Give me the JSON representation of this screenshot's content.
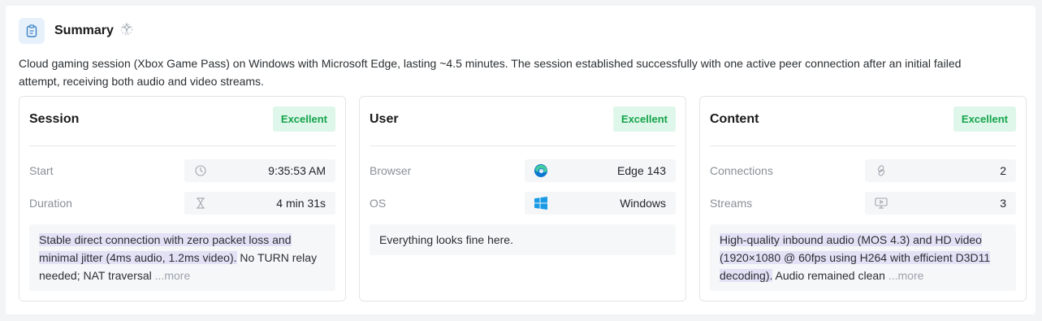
{
  "summary": {
    "title": "Summary",
    "description": "Cloud gaming session (Xbox Game Pass) on Windows with Microsoft Edge, lasting ~4.5 minutes. The session established successfully with one active peer connection after an initial failed attempt, receiving both audio and video streams."
  },
  "cards": {
    "session": {
      "title": "Session",
      "badge": "Excellent",
      "rows": [
        {
          "label": "Start",
          "icon": "clock-icon",
          "value": "9:35:53 AM"
        },
        {
          "label": "Duration",
          "icon": "hourglass-icon",
          "value": "4 min 31s"
        }
      ],
      "note_highlight": "Stable direct connection with zero packet loss and minimal jitter (4ms audio, 1.2ms video).",
      "note_text": " No TURN relay needed; NAT traversal ",
      "note_more": "...more"
    },
    "user": {
      "title": "User",
      "badge": "Excellent",
      "rows": [
        {
          "label": "Browser",
          "icon": "edge-icon",
          "value": "Edge 143"
        },
        {
          "label": "OS",
          "icon": "windows-icon",
          "value": "Windows"
        }
      ],
      "note_text": "Everything looks fine here."
    },
    "content": {
      "title": "Content",
      "badge": "Excellent",
      "rows": [
        {
          "label": "Connections",
          "icon": "link-icon",
          "value": "2"
        },
        {
          "label": "Streams",
          "icon": "monitor-icon",
          "value": "3"
        }
      ],
      "note_highlight": "High-quality inbound audio (MOS 4.3) and HD video (1920×1080 @ 60fps using H264 with efficient D3D11 decoding).",
      "note_text": " Audio remained clean ",
      "note_more": "...more"
    }
  },
  "colors": {
    "badge_bg": "#def7ea",
    "badge_text": "#16a34a",
    "highlight": "#e4e1f6",
    "header_icon_bg": "#e6f1fb"
  }
}
